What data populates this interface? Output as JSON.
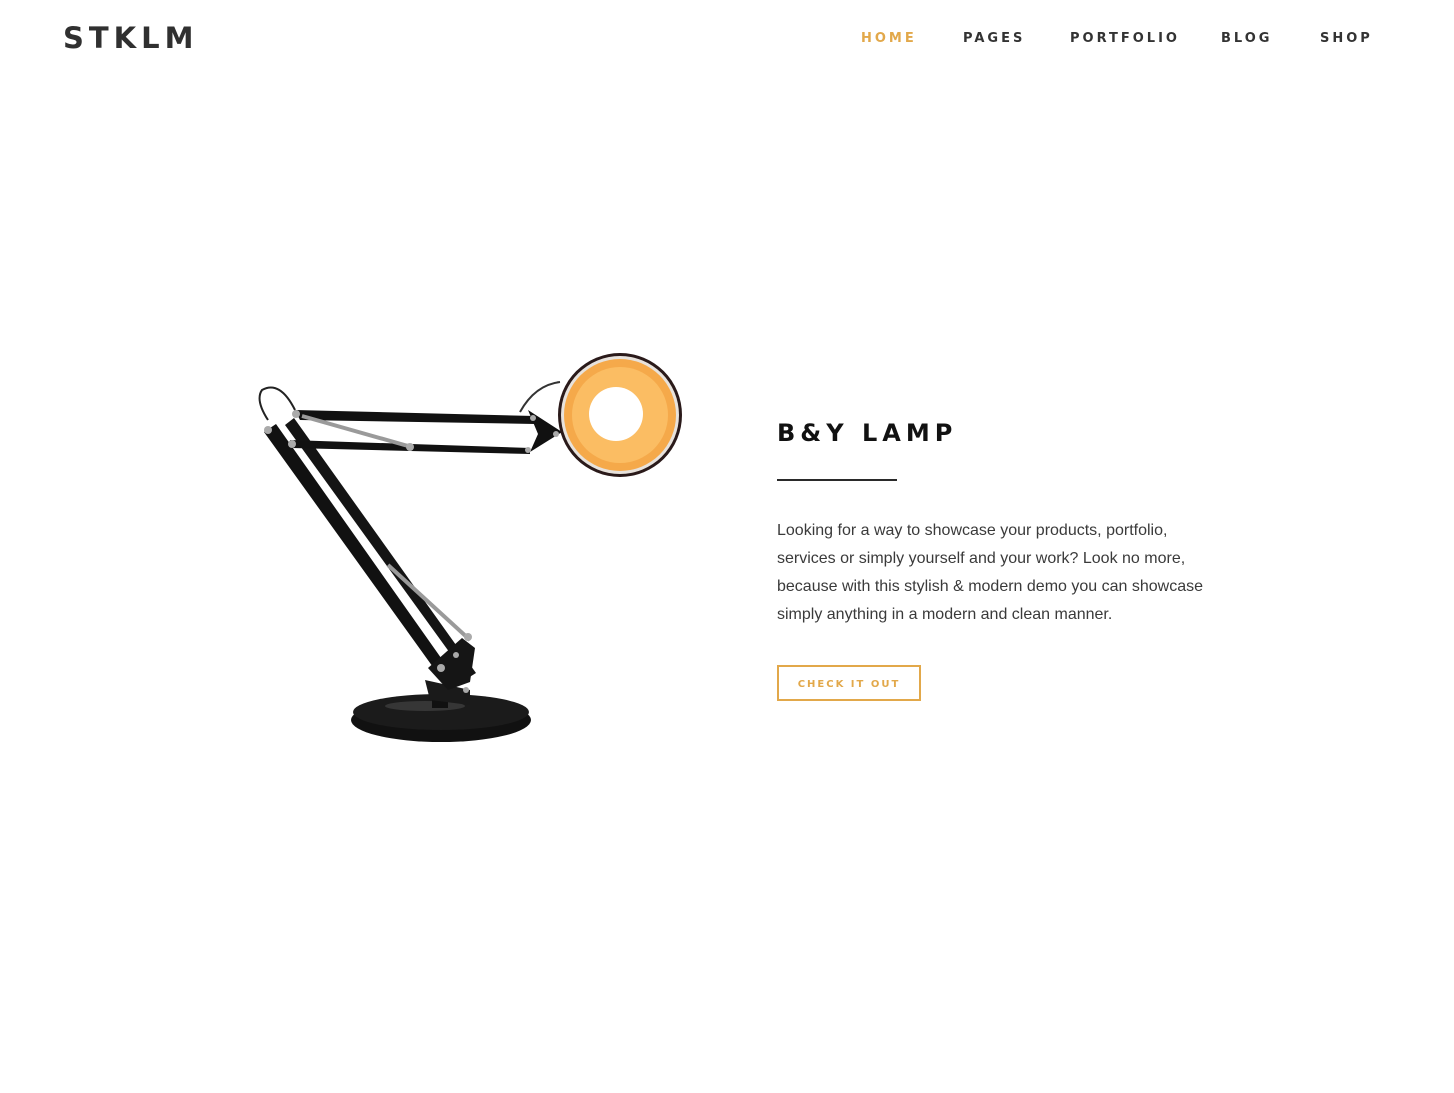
{
  "header": {
    "logo": "STKLM",
    "nav": [
      {
        "label": "HOME",
        "active": true
      },
      {
        "label": "PAGES",
        "active": false
      },
      {
        "label": "PORTFOLIO",
        "active": false
      },
      {
        "label": "BLOG",
        "active": false
      },
      {
        "label": "SHOP",
        "active": false
      }
    ]
  },
  "product": {
    "title": "B&Y LAMP",
    "description": "Looking for a way to showcase your products, portfolio, services or simply yourself and your work? Look no more, because with this stylish & modern demo you can showcase simply anything in a modern and clean manner.",
    "cta_label": "CHECK IT OUT",
    "image_icon": "desk-lamp-icon"
  },
  "colors": {
    "accent": "#e2a84a",
    "text": "#3a3a3a",
    "heading": "#111111",
    "background": "#ffffff"
  }
}
